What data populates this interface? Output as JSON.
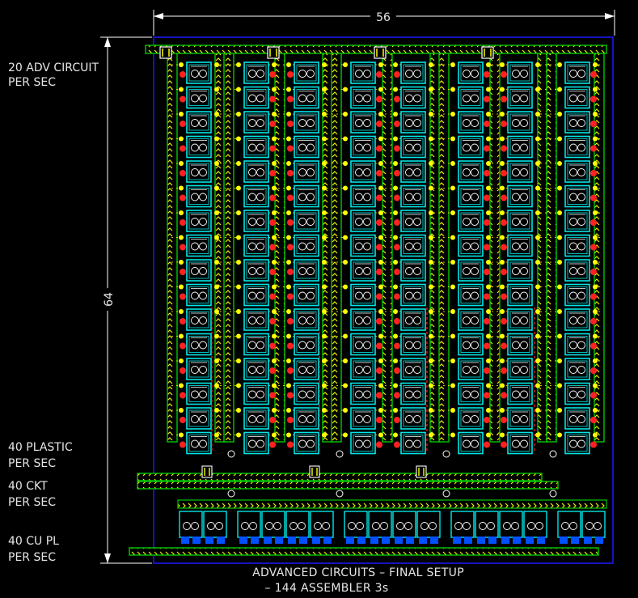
{
  "dimensions": {
    "width": "56",
    "height": "64"
  },
  "side_labels": {
    "adv_circuit": [
      "20 ADV CIRCUIT",
      "PER SEC"
    ],
    "plastic": [
      "40 PLASTIC",
      "PER SEC"
    ],
    "ckt": [
      "40 CKT",
      "PER SEC"
    ],
    "cu_pl": [
      "40 CU PL",
      "PER SEC"
    ]
  },
  "caption": [
    "ADVANCED CIRCUITS – FINAL SETUP",
    "– 144 ASSEMBLER 3s"
  ],
  "colors": {
    "background": "#000000",
    "frame": "#1a1aff",
    "belt_fill": "#f0f000",
    "belt_edge": "#00c800",
    "inserter": "#ffff00",
    "assembler": "#00e6e6",
    "pipe": "#ff2020",
    "chem_plant": "#0050ff",
    "dimension_line": "#ffffff",
    "text": "#e6e6e6"
  },
  "icons": [
    "assembler-icon",
    "belt-icon",
    "inserter-icon",
    "splitter-icon",
    "chemical-plant-icon"
  ]
}
